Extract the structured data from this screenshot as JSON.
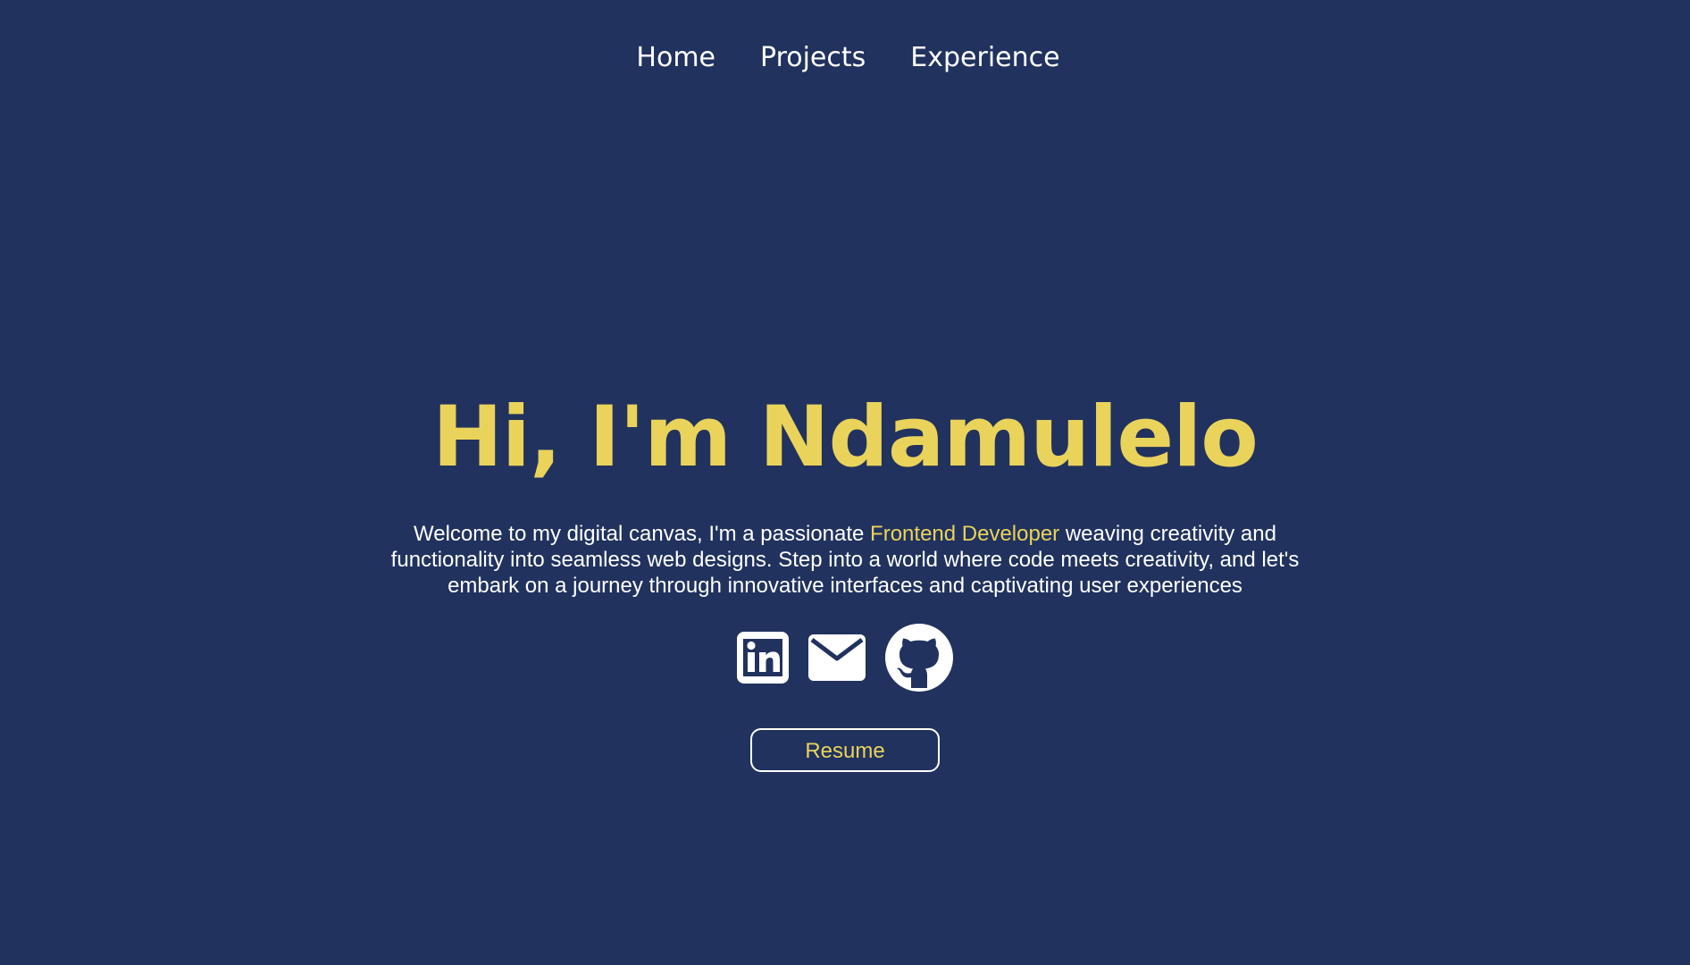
{
  "nav": {
    "items": [
      {
        "label": "Home"
      },
      {
        "label": "Projects"
      },
      {
        "label": "Experience"
      }
    ]
  },
  "hero": {
    "title": "Hi, I'm Ndamulelo",
    "intro_before": "Welcome to my digital canvas, I'm a passionate ",
    "intro_highlight": "Frontend Developer",
    "intro_after": " weaving creativity and functionality into seamless web designs. Step into a world where code meets creativity, and let's embark on a journey through innovative interfaces and captivating user experiences"
  },
  "socials": [
    {
      "icon": "linkedin-icon"
    },
    {
      "icon": "mail-icon"
    },
    {
      "icon": "github-icon"
    }
  ],
  "resume": {
    "label": "Resume"
  },
  "colors": {
    "background": "#21325e",
    "accent": "#e9d35b",
    "text": "#ffffff"
  }
}
